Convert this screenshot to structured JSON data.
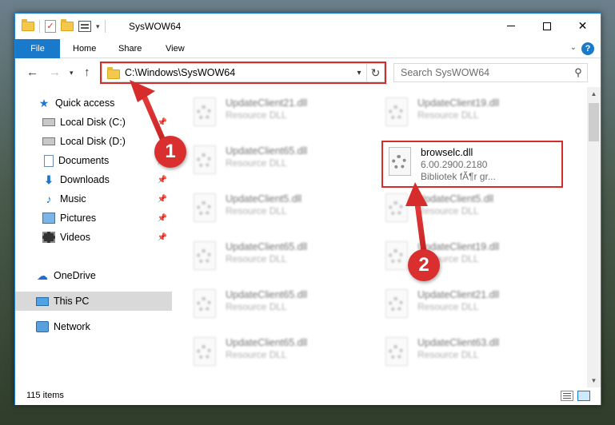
{
  "window": {
    "title": "SysWOW64"
  },
  "ribbon": {
    "tabs": [
      "File",
      "Home",
      "Share",
      "View"
    ]
  },
  "address": {
    "path": "C:\\Windows\\SysWOW64"
  },
  "search": {
    "placeholder": "Search SysWOW64"
  },
  "nav": {
    "items": [
      {
        "label": "Quick access",
        "icon": "star-icon"
      },
      {
        "label": "Local Disk (C:)",
        "icon": "drive-icon"
      },
      {
        "label": "Local Disk (D:)",
        "icon": "drive-icon"
      },
      {
        "label": "Documents",
        "icon": "documents-icon"
      },
      {
        "label": "Downloads",
        "icon": "download-icon"
      },
      {
        "label": "Music",
        "icon": "music-icon"
      },
      {
        "label": "Pictures",
        "icon": "pictures-icon"
      },
      {
        "label": "Videos",
        "icon": "videos-icon"
      },
      {
        "label": "OneDrive",
        "icon": "cloud-icon"
      },
      {
        "label": "This PC",
        "icon": "computer-icon"
      },
      {
        "label": "Network",
        "icon": "network-icon"
      }
    ]
  },
  "files": {
    "left": [
      {
        "name": "UpdateClient21.dll",
        "meta": "Resource DLL"
      },
      {
        "name": "UpdateClient65.dll",
        "meta": "Resource DLL"
      },
      {
        "name": "UpdateClient5.dll",
        "meta": "Resource DLL"
      },
      {
        "name": "UpdateClient65.dll",
        "meta": "Resource DLL"
      },
      {
        "name": "UpdateClient65.dll",
        "meta": "Resource DLL"
      },
      {
        "name": "UpdateClient65.dll",
        "meta": "Resource DLL"
      }
    ],
    "right": [
      {
        "name": "UpdateClient19.dll",
        "meta": "Resource DLL"
      },
      {
        "name": "UpdateClient5.dll",
        "meta": "Resource DLL"
      },
      {
        "name": "UpdateClient19.dll",
        "meta": "Resource DLL"
      },
      {
        "name": "UpdateClient21.dll",
        "meta": "Resource DLL"
      },
      {
        "name": "UpdateClient63.dll",
        "meta": "Resource DLL"
      }
    ],
    "highlighted": {
      "name": "browselc.dll",
      "version": "6.00.2900.2180",
      "description": "Bibliotek fÃ¶r gr..."
    }
  },
  "status": {
    "count": "115 items"
  },
  "annotations": {
    "marker1": "1",
    "marker2": "2"
  },
  "colors": {
    "accent": "#1979ca",
    "annotation": "#d62c2c"
  }
}
